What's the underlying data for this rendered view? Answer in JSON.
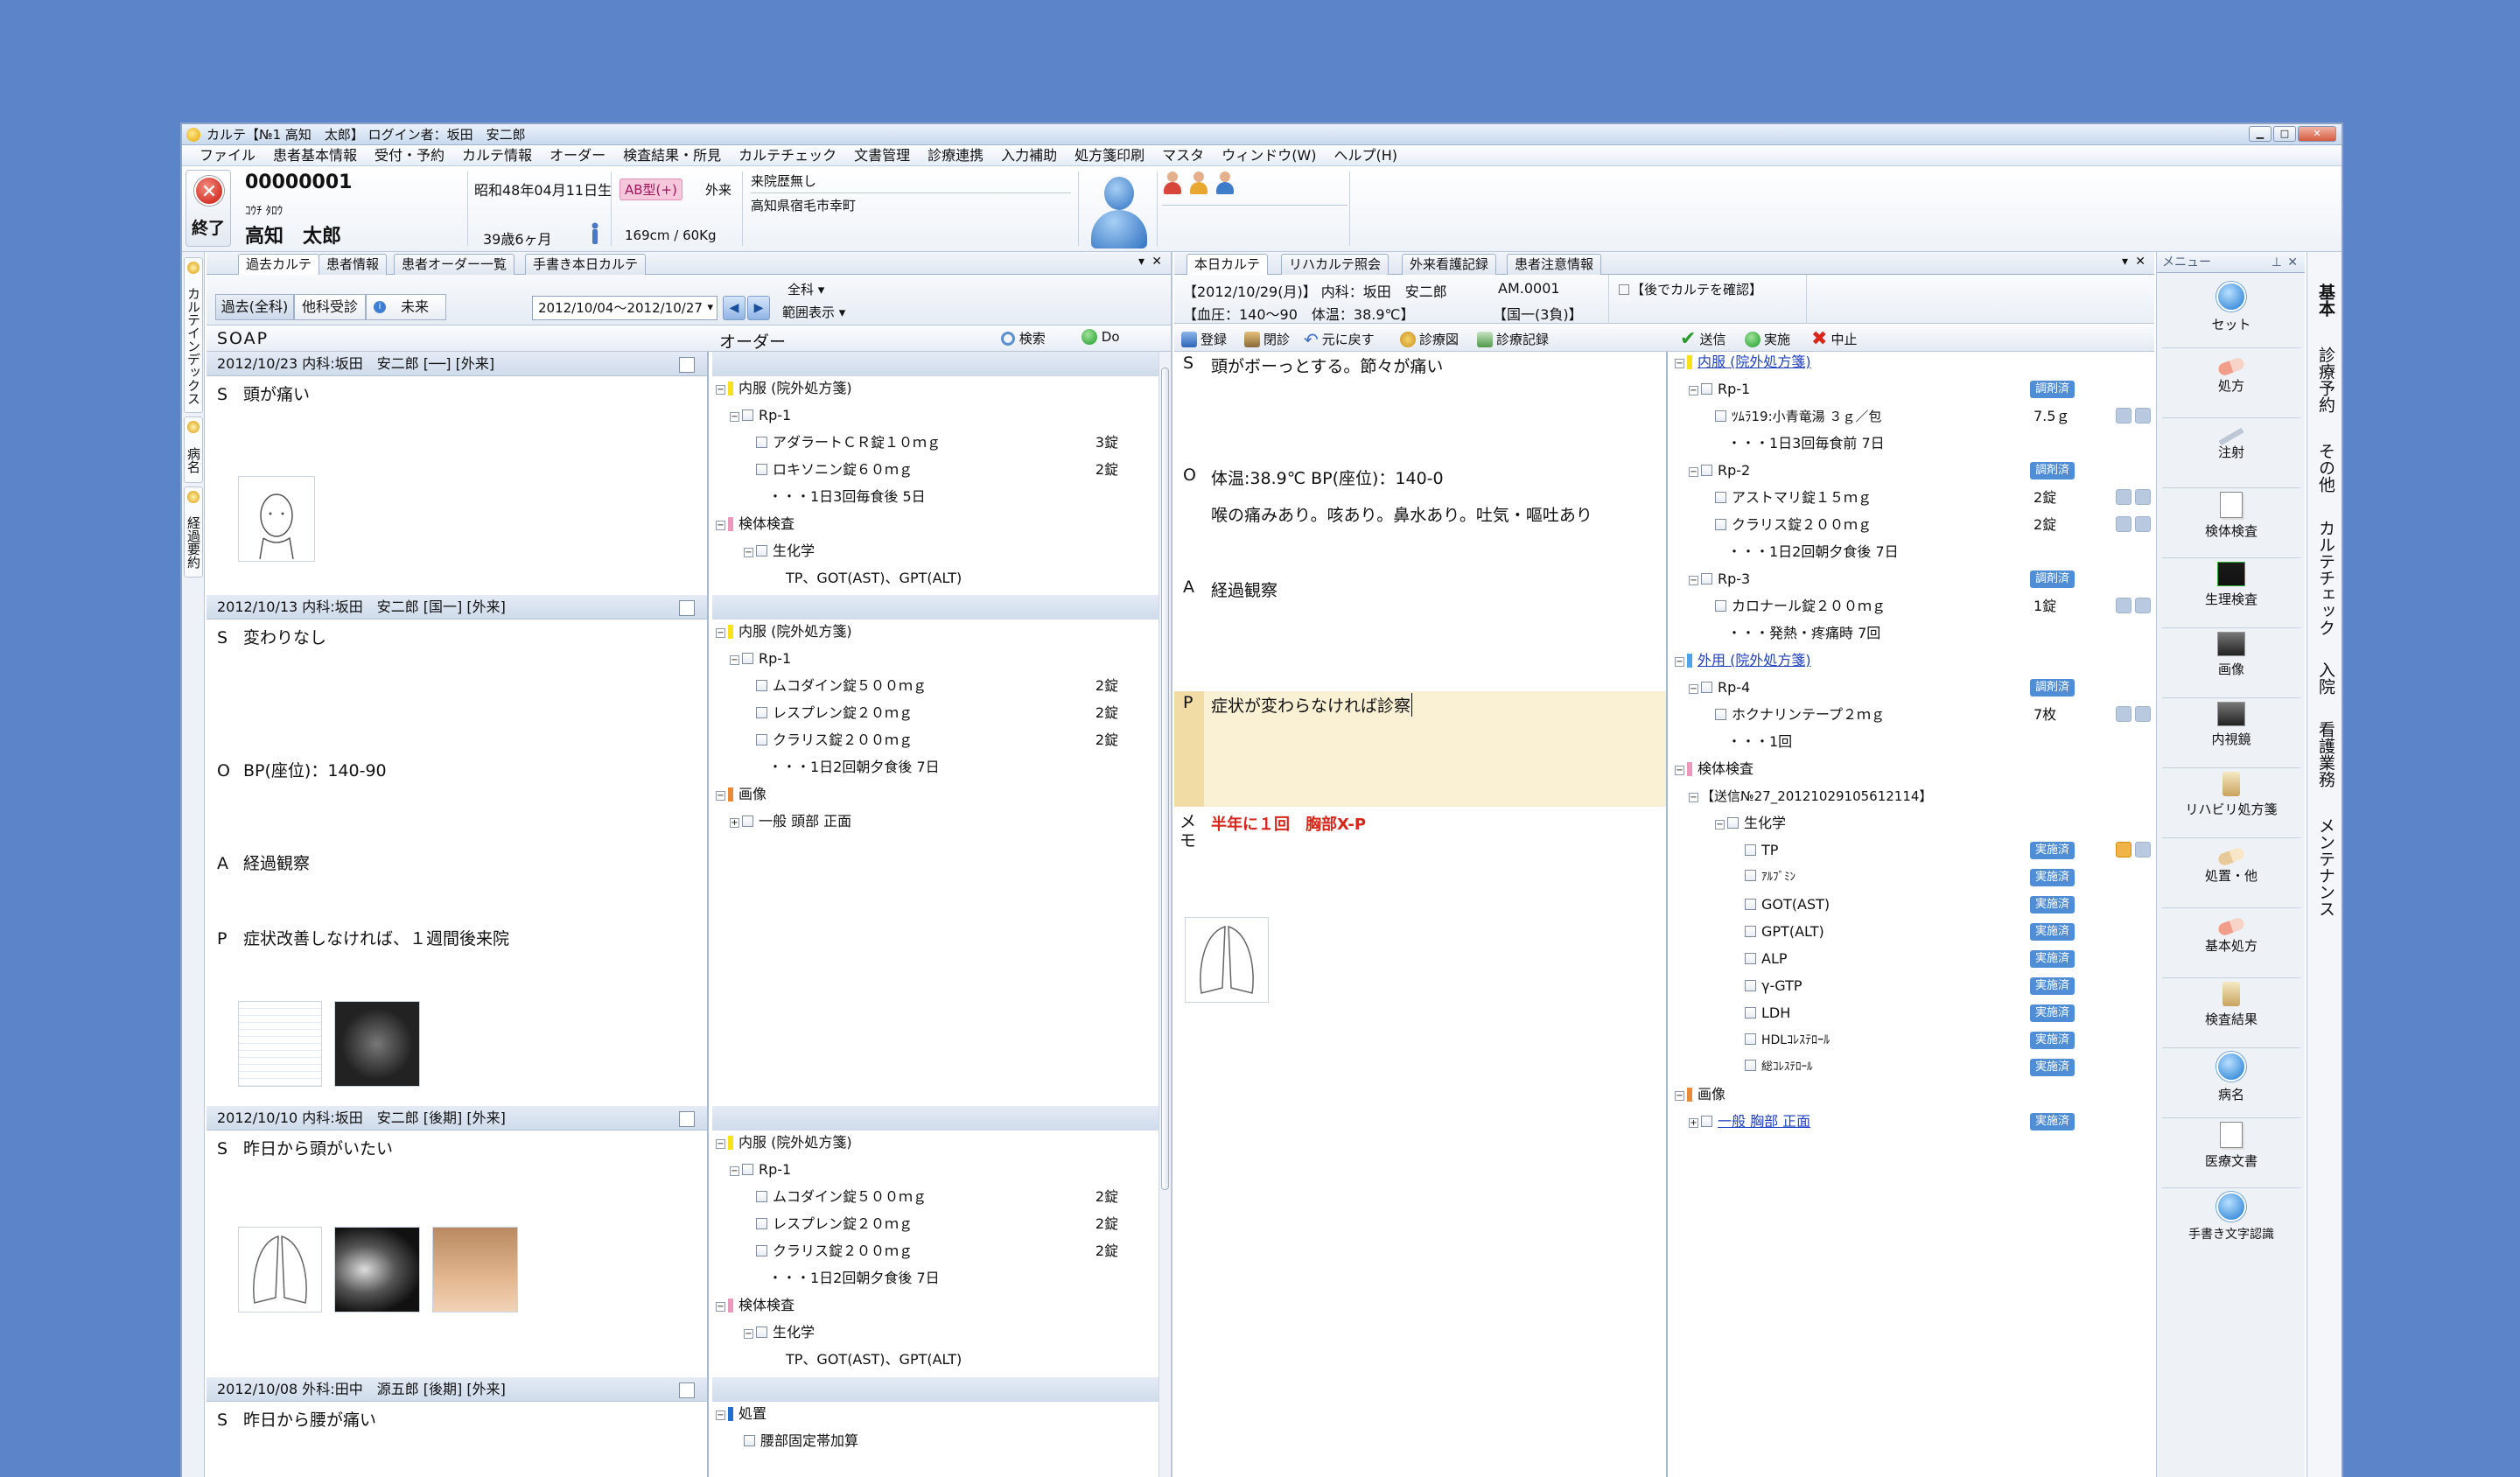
{
  "window": {
    "title": "カルテ【№1 高知　太郎】 ログイン者：坂田　安二郎"
  },
  "menu": [
    "ファイル",
    "患者基本情報",
    "受付・予約",
    "カルテ情報",
    "オーダー",
    "検査結果・所見",
    "カルテチェック",
    "文書管理",
    "診療連携",
    "入力補助",
    "処方箋印刷",
    "マスタ",
    "ウィンドウ(W)",
    "ヘルプ(H)"
  ],
  "patient": {
    "exit_label": "終了",
    "id": "00000001",
    "kana": "ｺｳﾁ ﾀﾛｳ",
    "name": "高知　太郎",
    "birth": "昭和48年04月11日生",
    "age": "39歳6ヶ月",
    "blood": "AB型(+)",
    "visit_type": "外来",
    "height_weight": "169cm / 60Kg",
    "history": "来院歴無し",
    "address": "高知県宿毛市幸町"
  },
  "left_strip": [
    "カルテインデックス",
    "病名",
    "経過要約"
  ],
  "left": {
    "tabs": [
      "過去カルテ",
      "患者情報",
      "患者オーダー一覧",
      "手書き本日カルテ"
    ],
    "filters": [
      "過去(全科)",
      "他科受診",
      "未来"
    ],
    "range": "2012/10/04～2012/10/27",
    "dept": "全科",
    "range_view": "範囲表示",
    "soap_header": "SOAP",
    "order_header": "オーダー",
    "search": "検索",
    "do": "Do",
    "entries": [
      {
        "header": "2012/10/23 内科:坂田　安二郎 [──] [外来]",
        "s": "頭が痛い"
      },
      {
        "header": "2012/10/13 内科:坂田　安二郎 [国一] [外来]",
        "s": "変わりなし",
        "o": "BP(座位)：140-90",
        "a": "経過観察",
        "p": "症状改善しなければ、１週間後来院"
      },
      {
        "header": "2012/10/10 内科:坂田　安二郎 [後期] [外来]",
        "s": "昨日から頭がいたい"
      },
      {
        "header": "2012/10/08 外科:田中　源五郎 [後期] [外来]",
        "s": "昨日から腰が痛い"
      }
    ],
    "soap_letters": {
      "s": "S",
      "o": "O",
      "a": "A",
      "p": "P"
    },
    "orders1": [
      {
        "t": "内服 (院外処方箋)"
      },
      {
        "t": "Rp-1"
      },
      {
        "t": "アダラートＣＲ錠１０ｍｇ",
        "q": "3錠"
      },
      {
        "t": "ロキソニン錠６０ｍｇ",
        "q": "2錠"
      },
      {
        "t": "・・・1日3回毎食後 5日"
      },
      {
        "t": "検体検査"
      },
      {
        "t": "生化学"
      },
      {
        "t": "TP、GOT(AST)、GPT(ALT)"
      }
    ],
    "orders2": [
      {
        "t": "内服 (院外処方箋)"
      },
      {
        "t": "Rp-1"
      },
      {
        "t": "ムコダイン錠５００ｍｇ",
        "q": "2錠"
      },
      {
        "t": "レスプレン錠２０ｍｇ",
        "q": "2錠"
      },
      {
        "t": "クラリス錠２００ｍｇ",
        "q": "2錠"
      },
      {
        "t": "・・・1日2回朝夕食後 7日"
      },
      {
        "t": "画像"
      },
      {
        "t": "一般 頭部 正面"
      }
    ],
    "orders3": [
      {
        "t": "内服 (院外処方箋)"
      },
      {
        "t": "Rp-1"
      },
      {
        "t": "ムコダイン錠５００ｍｇ",
        "q": "2錠"
      },
      {
        "t": "レスプレン錠２０ｍｇ",
        "q": "2錠"
      },
      {
        "t": "クラリス錠２００ｍｇ",
        "q": "2錠"
      },
      {
        "t": "・・・1日2回朝夕食後 7日"
      },
      {
        "t": "検体検査"
      },
      {
        "t": "生化学"
      },
      {
        "t": "TP、GOT(AST)、GPT(ALT)"
      }
    ],
    "orders4": [
      {
        "t": "処置"
      },
      {
        "t": "腰部固定帯加算"
      }
    ]
  },
  "mid": {
    "tabs": [
      "本日カルテ",
      "リハカルテ照会",
      "外来看護記録",
      "患者注意情報"
    ],
    "info1": "【2012/10/29(月)】 内科：坂田　安二郎",
    "info_code": "AM.0001",
    "info2": "【血圧：140～90　体温：38.9℃】",
    "insurance": "【国一(3負)】",
    "confirm": "【後でカルテを確認】",
    "toolbar": [
      "登録",
      "閉診",
      "元に戻す",
      "診療図",
      "診療記録"
    ],
    "toolbar_right": [
      "送信",
      "実施",
      "中止"
    ],
    "s": "頭がボーっとする。節々が痛い",
    "o1": "体温:38.9℃  BP(座位)：140-0",
    "o2": "喉の痛みあり。咳あり。鼻水あり。吐気・嘔吐あり",
    "a": "経過観察",
    "p": "症状が変わらなければ診察",
    "memo_label": "メモ",
    "memo": "半年に１回　胸部X-P",
    "order_tree": [
      {
        "t": "内服 (院外処方箋)",
        "link": true
      },
      {
        "t": "Rp-1",
        "st": "調剤済"
      },
      {
        "t": "ﾂﾑﾗ19:小青竜湯 ３ｇ／包",
        "q": "7.5ｇ"
      },
      {
        "t": "・・・1日3回毎食前 7日"
      },
      {
        "t": "Rp-2",
        "st": "調剤済"
      },
      {
        "t": "アストマリ錠１５ｍｇ",
        "q": "2錠"
      },
      {
        "t": "クラリス錠２００ｍｇ",
        "q": "2錠"
      },
      {
        "t": "・・・1日2回朝夕食後 7日"
      },
      {
        "t": "Rp-3",
        "st": "調剤済"
      },
      {
        "t": "カロナール錠２００ｍｇ",
        "q": "1錠"
      },
      {
        "t": "・・・発熱・疼痛時 7回"
      },
      {
        "t": "外用 (院外処方箋)",
        "link": true
      },
      {
        "t": "Rp-4",
        "st": "調剤済"
      },
      {
        "t": "ホクナリンテープ２ｍｇ",
        "q": "7枚"
      },
      {
        "t": "・・・1回"
      },
      {
        "t": "検体検査"
      },
      {
        "t": "【送信№27_20121029105612114】"
      },
      {
        "t": "生化学"
      },
      {
        "t": "TP",
        "st": "実施済"
      },
      {
        "t": "ｱﾙﾌﾞﾐﾝ",
        "st": "実施済"
      },
      {
        "t": "GOT(AST)",
        "st": "実施済"
      },
      {
        "t": "GPT(ALT)",
        "st": "実施済"
      },
      {
        "t": "ALP",
        "st": "実施済"
      },
      {
        "t": "γ-GTP",
        "st": "実施済"
      },
      {
        "t": "LDH",
        "st": "実施済"
      },
      {
        "t": "HDLｺﾚｽﾃﾛｰﾙ",
        "st": "実施済"
      },
      {
        "t": "総ｺﾚｽﾃﾛｰﾙ",
        "st": "実施済"
      },
      {
        "t": "画像"
      },
      {
        "t": "一般 胸部 正面",
        "link": true,
        "st": "実施済"
      }
    ]
  },
  "menu_panel": {
    "title": "メニュー",
    "items": [
      "セット",
      "処方",
      "注射",
      "検体検査",
      "生理検査",
      "画像",
      "内視鏡",
      "リハビリ処方箋",
      "処置・他",
      "基本処方",
      "検査結果",
      "病名",
      "医療文書",
      "手書き文字認識"
    ]
  },
  "side_tabs": [
    "基本",
    "診療予約",
    "その他",
    "カルテチェック",
    "入院",
    "看護業務",
    "メンテナンス"
  ]
}
